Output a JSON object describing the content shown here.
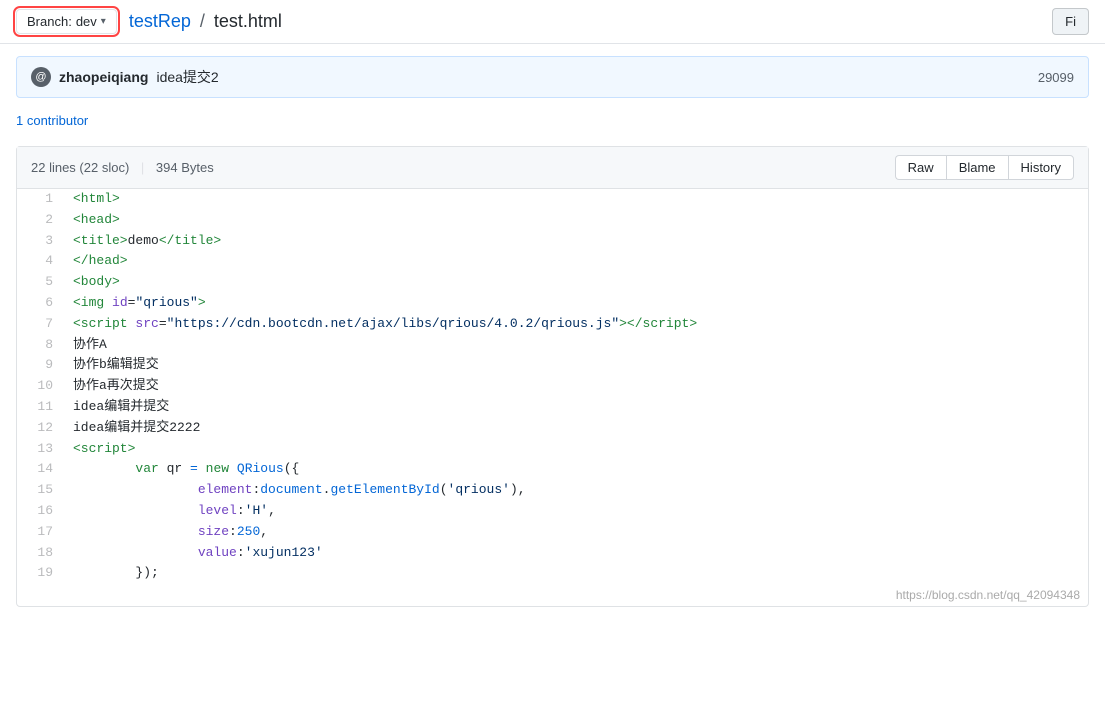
{
  "topbar": {
    "branch_label": "Branch:",
    "branch_name": "dev",
    "repo_name": "testRep",
    "file_name": "test.html",
    "find_file_btn": "Fi"
  },
  "commit": {
    "author": "zhaopeiqiang",
    "message": "idea提交2",
    "hash": "29099"
  },
  "contributors": {
    "label": "1 contributor"
  },
  "file_meta": {
    "lines": "22 lines (22 sloc)",
    "size": "394 Bytes"
  },
  "file_actions": {
    "raw": "Raw",
    "blame": "Blame",
    "history": "History"
  },
  "code_lines": [
    {
      "num": "1",
      "html": "<span class='tag'>&lt;html&gt;</span>"
    },
    {
      "num": "2",
      "html": "<span class='tag'>&lt;head&gt;</span>"
    },
    {
      "num": "3",
      "html": "<span class='tag'>&lt;title&gt;</span>demo<span class='tag'>&lt;/title&gt;</span>"
    },
    {
      "num": "4",
      "html": "<span class='tag'>&lt;/head&gt;</span>"
    },
    {
      "num": "5",
      "html": "<span class='tag'>&lt;body&gt;</span>"
    },
    {
      "num": "6",
      "html": "<span class='tag'>&lt;img</span> <span class='attr'>id</span>=<span class='str'>\"qrious\"</span><span class='tag'>&gt;</span>"
    },
    {
      "num": "7",
      "html": "<span class='tag'>&lt;script</span> <span class='attr'>src</span>=<span class='str'>\"https://cdn.bootcdn.net/ajax/libs/qrious/4.0.2/qrious.js\"</span><span class='tag'>&gt;&lt;/script&gt;</span>"
    },
    {
      "num": "8",
      "html": "协作A"
    },
    {
      "num": "9",
      "html": "协作b编辑提交"
    },
    {
      "num": "10",
      "html": "协作a再次提交"
    },
    {
      "num": "11",
      "html": "idea编辑并提交"
    },
    {
      "num": "12",
      "html": "idea编辑并提交2222"
    },
    {
      "num": "13",
      "html": "<span class='tag'>&lt;script&gt;</span>"
    },
    {
      "num": "14",
      "html": "        <span class='kw'>var</span> qr <span class='cn'>=</span> <span class='kw'>new</span> <span class='cn'>QRious</span>({"
    },
    {
      "num": "15",
      "html": "                <span class='attr'>element</span>:<span class='cn'>document</span>.<span class='cn'>getElementById</span>(<span class='str'>'qrious'</span>),"
    },
    {
      "num": "16",
      "html": "                <span class='attr'>level</span>:<span class='str'>'H'</span>,"
    },
    {
      "num": "17",
      "html": "                <span class='attr'>size</span>:<span class='cn'>250</span>,"
    },
    {
      "num": "18",
      "html": "                <span class='attr'>value</span>:<span class='str'>'xujun123'</span>"
    },
    {
      "num": "19",
      "html": "        });"
    }
  ],
  "watermark": "https://blog.csdn.net/qq_42094348"
}
